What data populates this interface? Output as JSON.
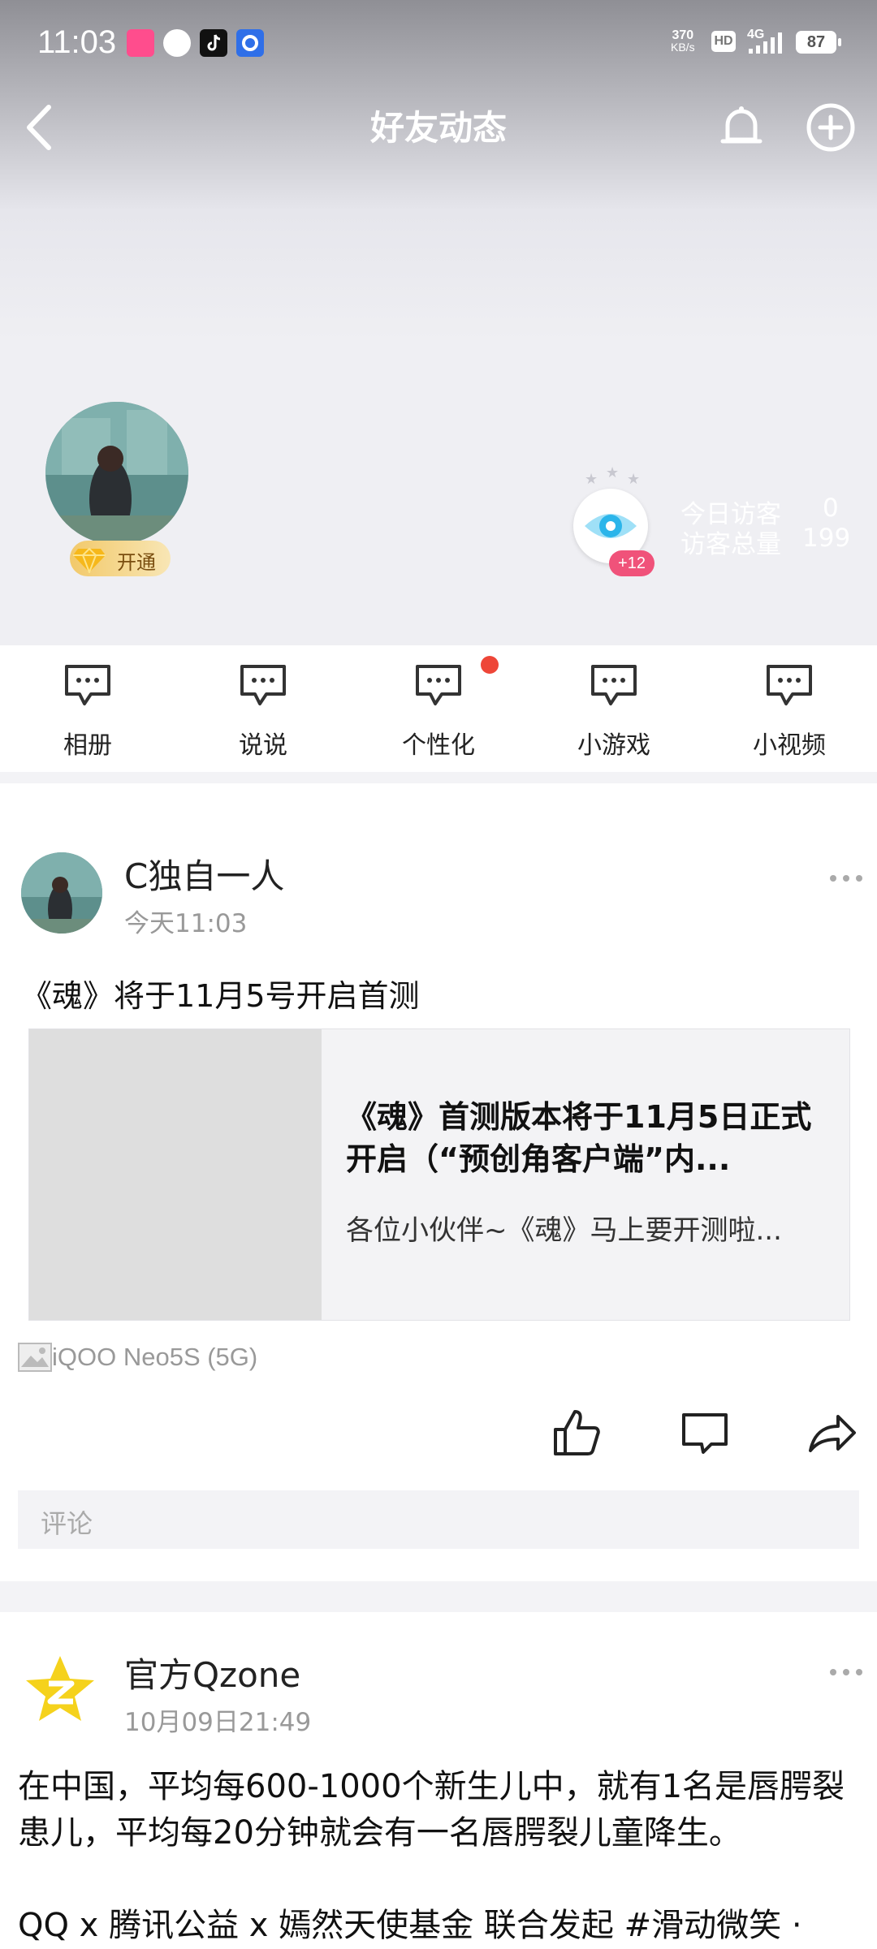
{
  "status_bar": {
    "time": "11:03",
    "net_speed_value": "370",
    "net_speed_unit": "KB/s",
    "hd": "HD",
    "network": "4G",
    "battery": "87"
  },
  "nav": {
    "title": "好友动态"
  },
  "profile": {
    "vip_label": "开通",
    "visitor_badge": "+12",
    "today_visitors_label": "今日访客",
    "today_visitors_value": "0",
    "total_visitors_label": "访客总量",
    "total_visitors_value": "199"
  },
  "shortcuts": [
    {
      "label": "相册",
      "icon": "chat-bubble-icon"
    },
    {
      "label": "说说",
      "icon": "chat-bubble-icon"
    },
    {
      "label": "个性化",
      "icon": "chat-bubble-icon"
    },
    {
      "label": "小游戏",
      "icon": "chat-bubble-icon"
    },
    {
      "label": "小视频",
      "icon": "chat-bubble-icon"
    }
  ],
  "posts": [
    {
      "author": "C独自一人",
      "time": "今天11:03",
      "text": "《魂》将于11月5号开启首测",
      "share": {
        "title": "《魂》首测版本将于11月5日正式开启（“预创角客户端”内...",
        "desc": "各位小伙伴~《魂》马上要开测啦..."
      },
      "device": "iQOO Neo5S (5G)",
      "comment_placeholder": "评论"
    },
    {
      "author": "官方Qzone",
      "time": "10月09日21:49",
      "text": "在中国，平均每600-1000个新生儿中，就有1名是唇腭裂患儿，平均每20分钟就会有一名唇腭裂儿童降生。",
      "text2": "QQ x 腾讯公益 x 嫣然天使基金 联合发起 #滑动微笑 ·"
    }
  ],
  "colors": {
    "accent_red": "#ee4638",
    "badge_pink": "#f0527a",
    "vip_gold": "#f2c96a",
    "qzone_yellow": "#f5d21c",
    "eye_blue": "#2bb5ea"
  }
}
